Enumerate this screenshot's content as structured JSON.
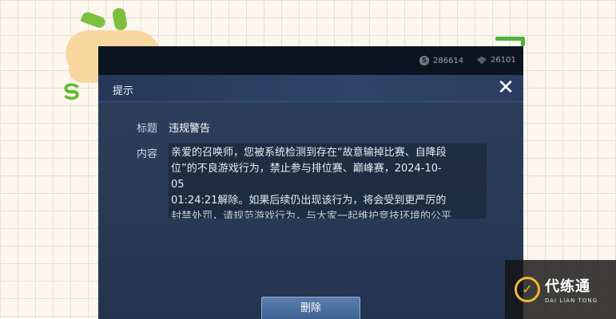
{
  "top_bar": {
    "coins": "286614",
    "gems": "26101"
  },
  "dialog": {
    "title": "提示",
    "close_label": "✕",
    "subject_label": "标题",
    "subject_value": "违规警告",
    "content_label": "内容",
    "content_lines": [
      "亲爱的召唤师，您被系统检测到存在“故意输掉比赛、自降段",
      "位”的不良游戏行为，禁止参与排位赛、巅峰赛，2024-10-",
      "05",
      "01:24:21解除。如果后续仍出现该行为，将会受到更严厉的",
      "封禁处罚，请规范游戏行为，与大家一起维护竞技环境的公平"
    ],
    "delete_label": "删除"
  },
  "watermark": {
    "brand": "代练通",
    "sub": "DAI LIAN TONG"
  },
  "colors": {
    "dialog_bg": "#2d3f5c",
    "button": "#4a6d9c",
    "watermark_accent": "#f2b632"
  }
}
